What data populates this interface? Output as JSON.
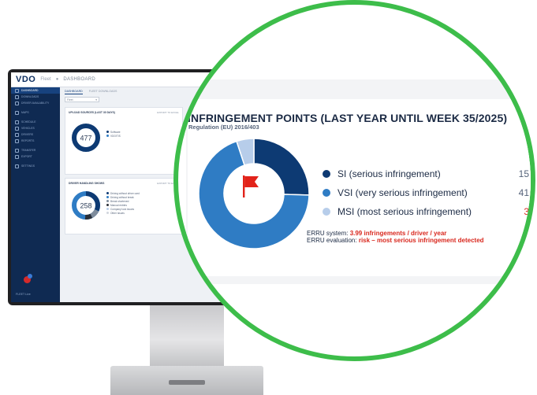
{
  "app": {
    "logo": "VDO",
    "logo_sub": "Fleet",
    "breadcrumb": "DASHBOARD"
  },
  "sidebar": {
    "items": [
      {
        "label": "DASHBOARD",
        "active": true
      },
      {
        "label": "DOWNLOADS"
      },
      {
        "label": "DRIVER AVAILABILITY"
      },
      {
        "label": "MAPS"
      },
      {
        "label": "SCHEDULE"
      },
      {
        "label": "VEHICLES"
      },
      {
        "label": "DRIVERS"
      },
      {
        "label": "REPORTS"
      },
      {
        "label": "TRANSFER"
      },
      {
        "label": "EXPORT"
      },
      {
        "label": "SETTINGS"
      }
    ],
    "footer": "FLEET Live"
  },
  "tabs": [
    "DASHBOARD",
    "FLEET DOWNLOADS"
  ],
  "filter": {
    "value": "Fleet"
  },
  "cards": [
    {
      "title": "UPLOAD SOURCES (LAST 30 DAYS)",
      "link": "EXPORT TO EXCEL",
      "center": "477",
      "legend": [
        "Software",
        "VDO/TIS"
      ]
    },
    {
      "title": "DRIVER HANDLING SHOWS",
      "link": "EXPORT TO EXCEL",
      "center": "258",
      "legend": [
        "Driving without driver card",
        "Driving without break",
        "Break shortened",
        "Manual entries",
        "Company lock issues",
        "Other issues"
      ]
    }
  ],
  "infringement": {
    "title": "INFRINGEMENT POINTS (LAST YEAR UNTIL WEEK 35/2025)",
    "subtitle": "Regulation (EU) 2016/403",
    "items": [
      {
        "label": "SI (serious infringement)",
        "value": 15,
        "color": "#0d3a73"
      },
      {
        "label": "VSI (very serious infringement)",
        "value": 41,
        "color": "#2f7cc4"
      },
      {
        "label": "MSI (most serious infringement)",
        "value": 3,
        "color": "#b7cdea"
      }
    ],
    "erru_system_label": "ERRU system:",
    "erru_system_value": "3.99 infringements / driver / year",
    "erru_eval_label": "ERRU evaluation:",
    "erru_eval_value": "risk – most serious infringement detected",
    "flag_color": "#e2231a",
    "risk_color": "#d9281e"
  },
  "colors": {
    "accent": "#3dbd4a",
    "navy": "#0f2a52"
  }
}
